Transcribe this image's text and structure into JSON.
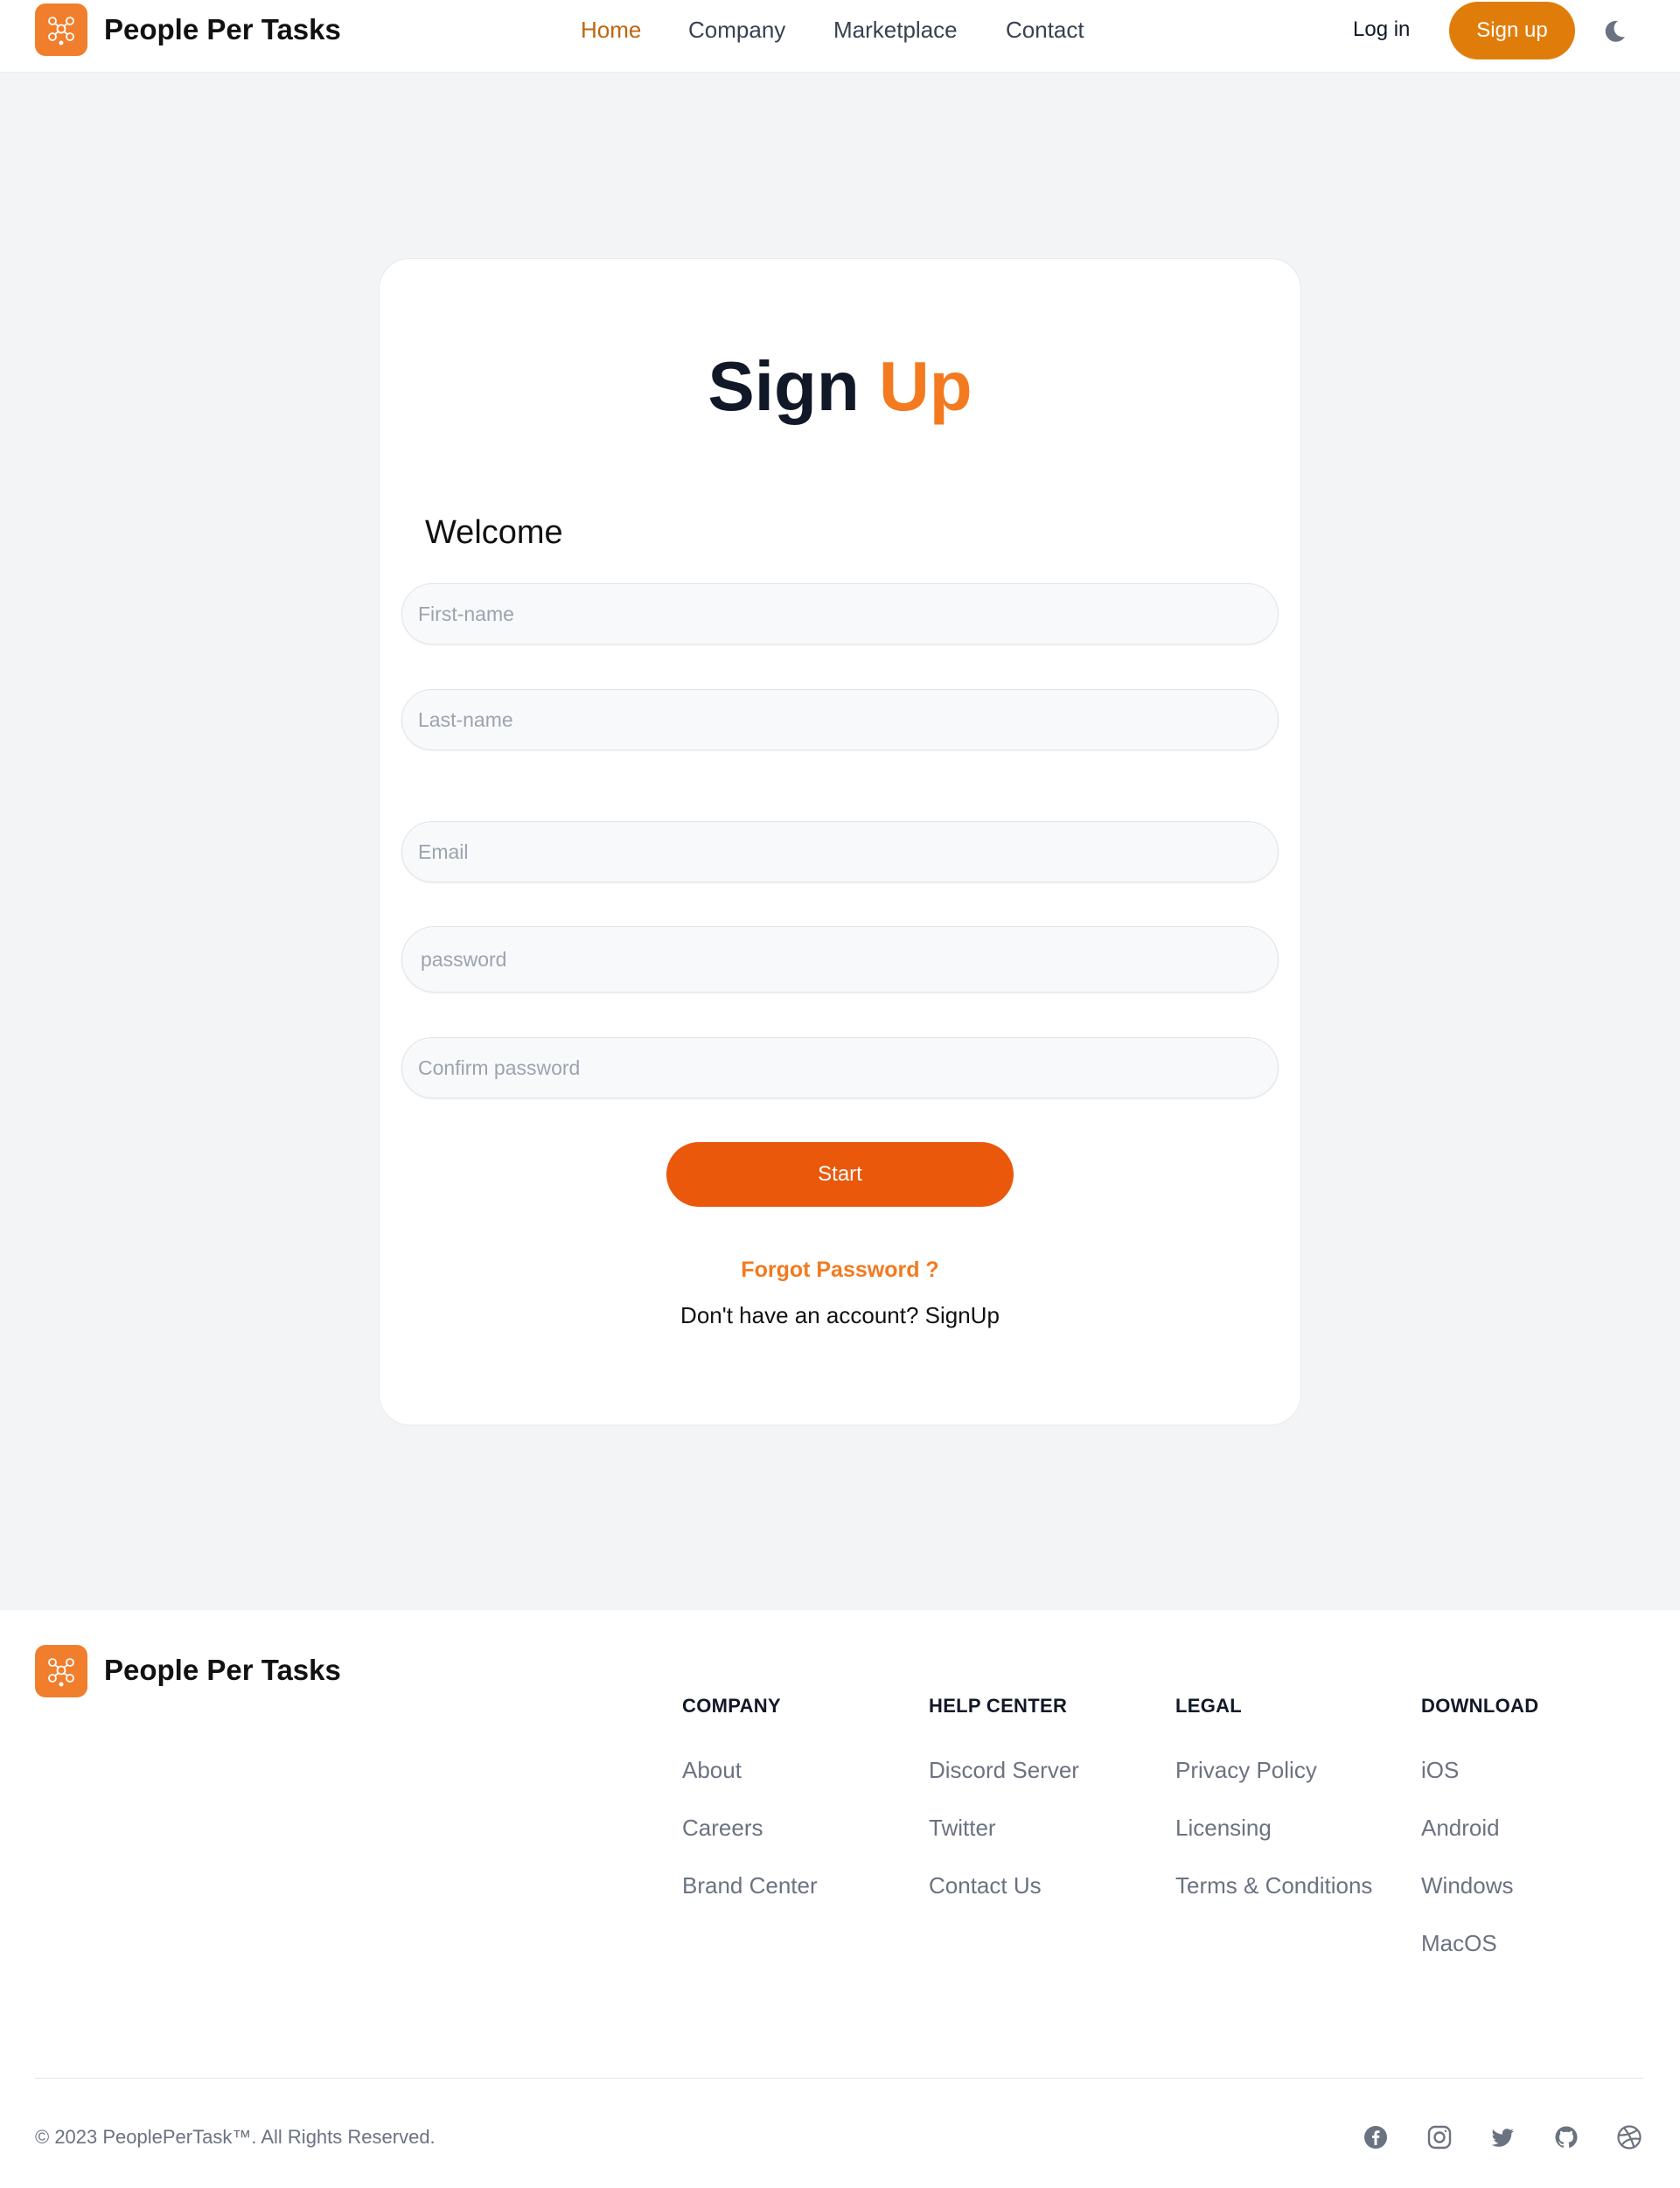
{
  "header": {
    "brand": "People Per Tasks",
    "nav": [
      {
        "label": "Home",
        "active": true
      },
      {
        "label": "Company",
        "active": false
      },
      {
        "label": "Marketplace",
        "active": false
      },
      {
        "label": "Contact",
        "active": false
      }
    ],
    "login_label": "Log in",
    "signup_label": "Sign up",
    "theme_icon": "moon-icon"
  },
  "form": {
    "title_main": "Sign",
    "title_accent": "Up",
    "welcome": "Welcome",
    "fields": {
      "first_name": "First-name",
      "last_name": "Last-name",
      "email": "Email",
      "password": "password",
      "confirm_password": "Confirm password"
    },
    "start_label": "Start",
    "forgot_label": "Forgot Password ?",
    "no_account_text": "Don't have an account? SignUp"
  },
  "footer": {
    "brand": "People Per Tasks",
    "columns": [
      {
        "title": "COMPANY",
        "links": [
          "About",
          "Careers",
          "Brand Center"
        ]
      },
      {
        "title": "HELP CENTER",
        "links": [
          "Discord Server",
          "Twitter",
          "Contact Us"
        ]
      },
      {
        "title": "LEGAL",
        "links": [
          "Privacy Policy",
          "Licensing",
          "Terms & Conditions"
        ]
      },
      {
        "title": "DOWNLOAD",
        "links": [
          "iOS",
          "Android",
          "Windows",
          "MacOS"
        ]
      }
    ],
    "copyright": "© 2023 PeoplePerTask™. All Rights Reserved.",
    "social_icons": [
      "facebook-icon",
      "instagram-icon",
      "twitter-icon",
      "github-icon",
      "dribbble-icon"
    ]
  },
  "colors": {
    "brand_orange": "#f07e2c",
    "accent_orange": "#f37a1f",
    "signup_button": "#e07d0a",
    "start_button": "#ea580c",
    "nav_active": "#c2640e",
    "page_bg": "#f3f4f6"
  }
}
